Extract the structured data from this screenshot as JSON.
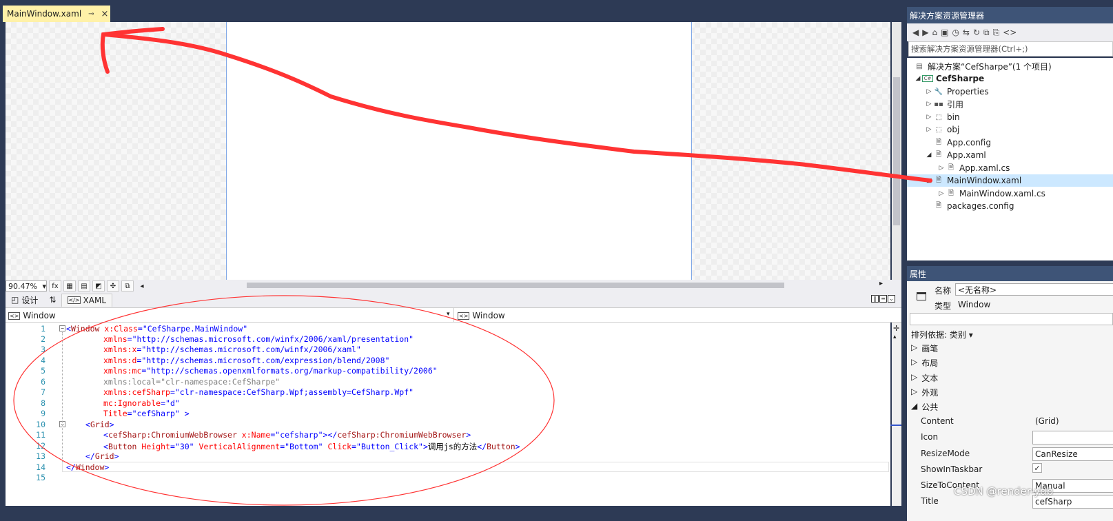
{
  "document_tab": {
    "title": "MainWindow.xaml",
    "pin": "⊸",
    "close": "×"
  },
  "designer": {
    "zoom": "90.47%",
    "fx": "fx"
  },
  "view_tabs": {
    "design": "设计",
    "swap": "⇅",
    "xaml": "XAML"
  },
  "nav": {
    "left": "Window",
    "right": "Window"
  },
  "code": {
    "lines": [
      "1",
      "2",
      "3",
      "4",
      "5",
      "6",
      "7",
      "8",
      "9",
      "10",
      "11",
      "12",
      "13",
      "14",
      "15"
    ],
    "l1_open": "<",
    "l1_tag": "Window",
    "l1_attr": " x:Class",
    "l1_eq": "=",
    "l1_val": "\"CefSharpe.MainWindow\"",
    "l2_attr": "xmlns",
    "l2_val": "\"http://schemas.microsoft.com/winfx/2006/xaml/presentation\"",
    "l3_attr": "xmlns:x",
    "l3_val": "\"http://schemas.microsoft.com/winfx/2006/xaml\"",
    "l4_attr": "xmlns:d",
    "l4_val": "\"http://schemas.microsoft.com/expression/blend/2008\"",
    "l5_attr": "xmlns:mc",
    "l5_val": "\"http://schemas.openxmlformats.org/markup-compatibility/2006\"",
    "l6": "xmlns:local=\"clr-namespace:CefSharpe\"",
    "l7_attr": "xmlns:cefSharp",
    "l7_val": "\"clr-namespace:CefSharp.Wpf;assembly=CefSharp.Wpf\"",
    "l8_attr": "mc:Ignorable",
    "l8_val": "\"d\"",
    "l9_attr": "Title",
    "l9_val": "\"cefSharp\"",
    "l9_end": " >",
    "l10_tag": "Grid",
    "l11_tag": "cefSharp:ChromiumWebBrowser",
    "l11_attr": " x:Name",
    "l11_val": "\"cefsharp\"",
    "l12_tag": "Button",
    "l12_a1": " Height",
    "l12_v1": "\"30\"",
    "l12_a2": " VerticalAlignment",
    "l12_v2": "\"Bottom\"",
    "l12_a3": " Click",
    "l12_v3": "\"Button_Click\"",
    "l12_text": "调用js的方法",
    "l13_tag": "Grid",
    "l14_tag": "Window"
  },
  "solution_explorer": {
    "title": "解决方案资源管理器",
    "search_placeholder": "搜索解决方案资源管理器(Ctrl+;)",
    "items": [
      {
        "label": "解决方案“CefSharpe”(1 个项目)",
        "icon": "solution-icon"
      },
      {
        "label": "CefSharpe",
        "icon": "csharp-project-icon"
      },
      {
        "label": "Properties",
        "icon": "wrench-icon"
      },
      {
        "label": "引用",
        "icon": "references-icon"
      },
      {
        "label": "bin",
        "icon": "folder-icon"
      },
      {
        "label": "obj",
        "icon": "folder-icon"
      },
      {
        "label": "App.config",
        "icon": "config-file-icon"
      },
      {
        "label": "App.xaml",
        "icon": "xaml-file-icon"
      },
      {
        "label": "App.xaml.cs",
        "icon": "cs-file-icon"
      },
      {
        "label": "MainWindow.xaml",
        "icon": "xaml-file-icon"
      },
      {
        "label": "MainWindow.xaml.cs",
        "icon": "cs-file-icon"
      },
      {
        "label": "packages.config",
        "icon": "config-file-icon"
      }
    ]
  },
  "properties": {
    "title": "属性",
    "name_label": "名称",
    "name_value": "<无名称>",
    "type_label": "类型",
    "type_value": "Window",
    "sort_label": "排列依据: 类别",
    "categories": [
      "画笔",
      "布局",
      "文本",
      "外观",
      "公共"
    ],
    "rows": [
      {
        "label": "Content",
        "value": "(Grid)"
      },
      {
        "label": "Icon",
        "value": ""
      },
      {
        "label": "ResizeMode",
        "value": "CanResize"
      },
      {
        "label": "ShowInTaskbar",
        "value": "✓"
      },
      {
        "label": "SizeToContent",
        "value": "Manual"
      },
      {
        "label": "Title",
        "value": "cefSharp"
      }
    ]
  },
  "watermark": "CSDN @render-ydb",
  "colors": {
    "annotation_red": "#ff3333",
    "header_blue": "#3e5477",
    "selection": "#cce8ff"
  }
}
